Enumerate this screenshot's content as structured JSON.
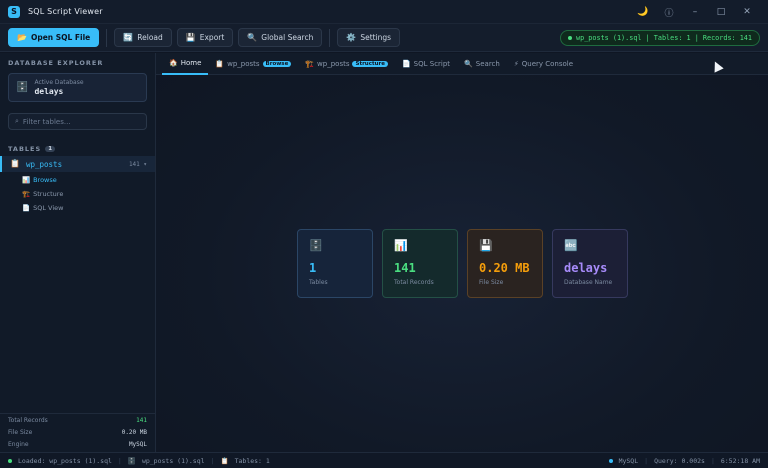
{
  "app": {
    "title": "SQL Script Viewer",
    "icon": "S"
  },
  "window": {
    "theme_icon": "🌙",
    "info_icon": "ⓘ",
    "min": "–",
    "max": "□",
    "close": "✕"
  },
  "toolbar": {
    "open_label": "Open SQL File",
    "reload_label": "Reload",
    "export_label": "Export",
    "search_label": "Global Search",
    "settings_label": "Settings",
    "status": "wp_posts (1).sql | Tables: 1 | Records: 141"
  },
  "sidebar": {
    "header": "DATABASE EXPLORER",
    "active_db_label": "Active Database",
    "active_db": "delays",
    "filter_placeholder": "Filter tables...",
    "tables_header": "TABLES",
    "tables_count": "1",
    "table": {
      "name": "wp_posts",
      "count": "141 ▾"
    },
    "sub_items": [
      "Browse",
      "Structure",
      "SQL View"
    ],
    "stats": [
      {
        "label": "Total Records",
        "value": "141"
      },
      {
        "label": "File Size",
        "value": "0.20 MB"
      },
      {
        "label": "Engine",
        "value": "MySQL"
      }
    ]
  },
  "tabs": [
    {
      "label": "Home"
    },
    {
      "label": "wp_posts",
      "tag": "Browse"
    },
    {
      "label": "wp_posts",
      "tag": "Structure"
    },
    {
      "label": "SQL Script"
    },
    {
      "label": "Search"
    },
    {
      "label": "Query Console"
    }
  ],
  "cards": [
    {
      "value": "1",
      "label": "Tables"
    },
    {
      "value": "141",
      "label": "Total Records"
    },
    {
      "value": "0.20 MB",
      "label": "File Size"
    },
    {
      "value": "delays",
      "label": "Database Name"
    }
  ],
  "statusbar": {
    "loaded": "Loaded: wp_posts (1).sql",
    "table": "wp_posts (1).sql",
    "tables": "Tables: 1",
    "engine": "MySQL",
    "query": "Query: 0.002s",
    "time": "6:52:18 AM"
  },
  "colors": {
    "accent": "#38bdf8",
    "green": "#4ade80",
    "orange": "#f59e0b",
    "purple": "#a78bfa"
  }
}
